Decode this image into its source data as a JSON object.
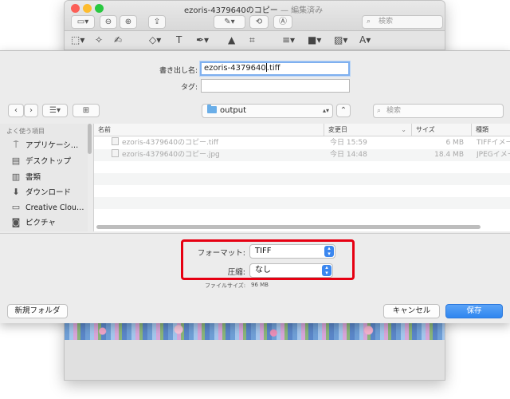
{
  "bg_window": {
    "title": "ezoris-4379640のコピー",
    "title_suffix": "— 編集済み",
    "search_placeholder": "検索",
    "colors": {
      "close": "#fc5f57",
      "minimize": "#fdbc2e",
      "zoom": "#28c840"
    }
  },
  "dialog": {
    "export_as_label": "書き出し名:",
    "export_as_value": "ezoris-4379640",
    "export_as_ext": ".tiff",
    "tags_label": "タグ:",
    "tags_value": "",
    "location": "output",
    "search_placeholder": "検索",
    "sidebar": {
      "section_title": "よく使う項目",
      "items": [
        {
          "label": "アプリケーシ…",
          "icon": "apps-icon"
        },
        {
          "label": "デスクトップ",
          "icon": "desktop-icon"
        },
        {
          "label": "書類",
          "icon": "documents-icon"
        },
        {
          "label": "ダウンロード",
          "icon": "download-icon"
        },
        {
          "label": "Creative Clou…",
          "icon": "folder-icon"
        },
        {
          "label": "ピクチャ",
          "icon": "camera-icon"
        }
      ]
    },
    "columns": {
      "name": "名前",
      "modified": "変更日",
      "size": "サイズ",
      "kind": "種類"
    },
    "files": [
      {
        "name": "ezoris-4379640のコピー.tiff",
        "modified": "今日 15:59",
        "size": "6 MB",
        "kind": "TIFFイメージ"
      },
      {
        "name": "ezoris-4379640のコピー.jpg",
        "modified": "今日 14:48",
        "size": "18.4 MB",
        "kind": "JPEGイメージ"
      }
    ],
    "format_label": "フォーマット:",
    "format_value": "TIFF",
    "compression_label": "圧縮:",
    "compression_value": "なし",
    "filesize_label": "ファイルサイズ:",
    "filesize_value": "96 MB",
    "new_folder_label": "新規フォルダ",
    "cancel_label": "キャンセル",
    "save_label": "保存",
    "highlight_color": "#e60012",
    "accent_color": "#2f86ef"
  }
}
